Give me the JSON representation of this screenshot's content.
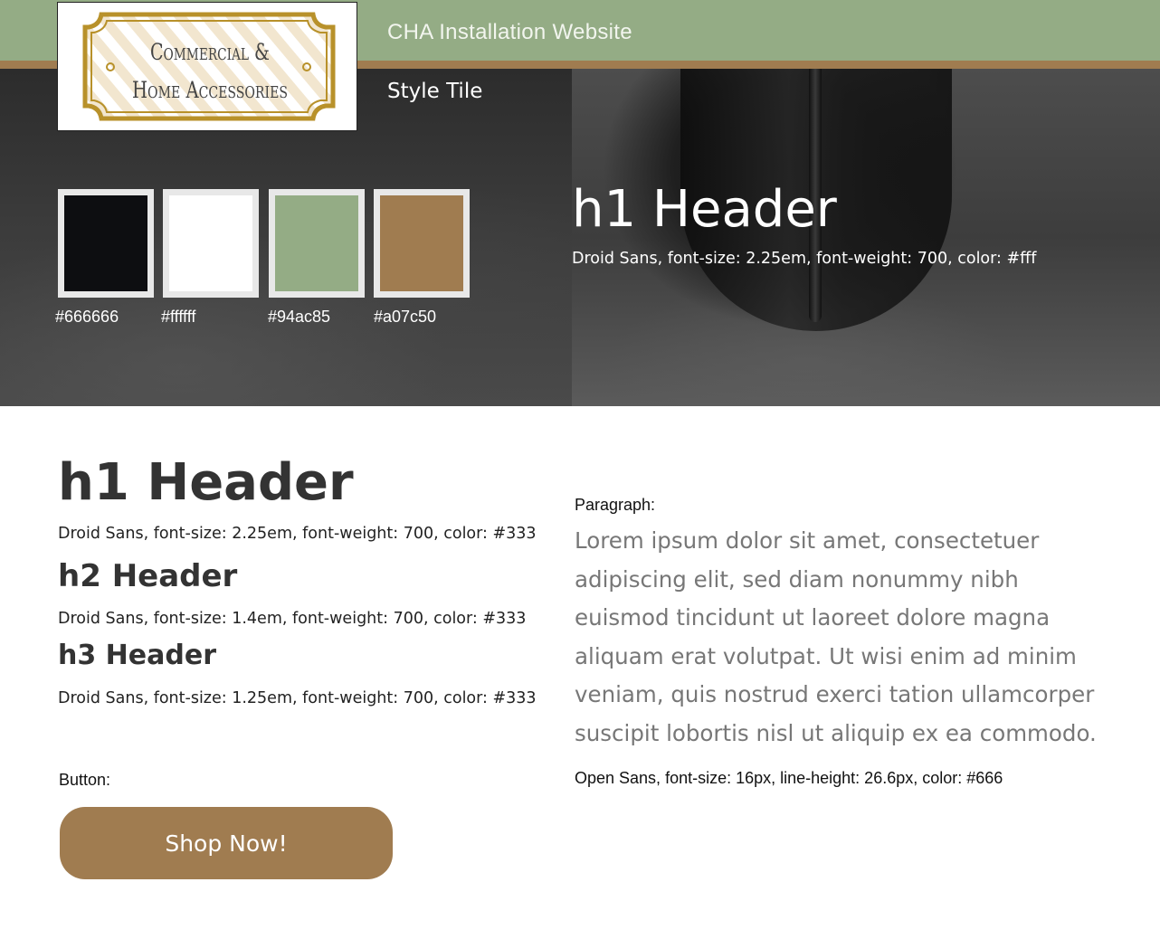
{
  "header": {
    "site_title": "CHA Installation Website",
    "page_label": "Style Tile"
  },
  "logo": {
    "line1": "Commercial &",
    "line2": "Home Accessories"
  },
  "swatches": [
    {
      "code": "#666666",
      "color": "#0d0e11"
    },
    {
      "code": "#ffffff",
      "color": "#ffffff"
    },
    {
      "code": "#94ac85",
      "color": "#94ac85"
    },
    {
      "code": "#a07c50",
      "color": "#a07c50"
    }
  ],
  "hero": {
    "h1": "h1 Header",
    "h1_spec": "Droid Sans, font-size: 2.25em, font-weight: 700, color: #fff"
  },
  "typography": {
    "h1": "h1 Header",
    "h1_spec": "Droid Sans, font-size: 2.25em, font-weight: 700, color: #333",
    "h2": "h2 Header",
    "h2_spec": "Droid Sans, font-size: 1.4em, font-weight: 700,  color: #333",
    "h3": "h3 Header",
    "h3_spec": "Droid Sans, font-size: 1.25em, font-weight: 700,  color: #333"
  },
  "button": {
    "label": "Button:",
    "text": "Shop Now!"
  },
  "paragraph": {
    "label": "Paragraph:",
    "body": "Lorem ipsum dolor sit amet, consectetuer adipiscing elit, sed diam nonummy nibh euismod tincidunt ut laoreet dolore magna aliquam erat volutpat. Ut wisi enim ad minim veniam, quis nostrud exerci tation ullamcorper suscipit lobortis nisl ut aliquip ex ea commodo.",
    "spec": "Open Sans, font-size: 16px, line-height: 26.6px, color: #666"
  },
  "colors": {
    "green": "#94ac85",
    "brown": "#a07c50",
    "text_dark": "#333333",
    "text_paragraph": "#666666",
    "logo_gold": "#b8912a"
  }
}
